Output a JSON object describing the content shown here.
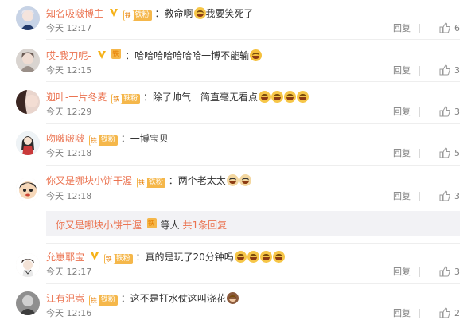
{
  "comments": [
    {
      "user": "知名吸啵博主",
      "verified": true,
      "fan_label": "铁粉",
      "text": "救命啊",
      "text2": "我要笑死了",
      "emojis_mid": [
        "laugh"
      ],
      "emojis_end": [],
      "time": "今天 12:17",
      "reply": "回复",
      "likes": "6"
    },
    {
      "user": "哎-我刀呢-",
      "verified": true,
      "fan_label": "",
      "text": "哈哈哈哈哈哈哈一博不能输",
      "text2": "",
      "emojis_mid": [],
      "emojis_end": [
        "shh"
      ],
      "time": "今天 12:15",
      "reply": "回复",
      "likes": "3"
    },
    {
      "user": "迦叶-一片冬麦",
      "verified": false,
      "fan_label": "铁粉",
      "text": "除了帅气　简直毫无看点",
      "text2": "",
      "emojis_mid": [],
      "emojis_end": [
        "laugh",
        "laugh",
        "laugh",
        "laugh"
      ],
      "time": "今天 12:29",
      "reply": "回复",
      "likes": "3"
    },
    {
      "user": "吻啵啵啵",
      "verified": false,
      "fan_label": "铁粉",
      "text": "一博宝贝",
      "text2": "",
      "emojis_mid": [],
      "emojis_end": [],
      "time": "今天 12:18",
      "reply": "回复",
      "likes": "5"
    },
    {
      "user": "你又是哪块小饼干渥",
      "verified": false,
      "fan_label": "铁粉",
      "text": "两个老太太",
      "text2": "",
      "emojis_mid": [],
      "emojis_end": [
        "cat",
        "cat"
      ],
      "time": "今天 12:18",
      "reply": "回复",
      "likes": "3"
    },
    {
      "user": "允崽耶宝",
      "verified": true,
      "fan_label": "铁粉",
      "text": "真的是玩了20分钟吗",
      "text2": "",
      "emojis_mid": [],
      "emojis_end": [
        "laugh",
        "laugh",
        "laugh",
        "laugh"
      ],
      "time": "今天 12:17",
      "reply": "回复",
      "likes": "3"
    },
    {
      "user": "江有汜嵩",
      "verified": false,
      "fan_label": "铁粉",
      "text": "这不是打水仗这叫浇花",
      "text2": "",
      "emojis_mid": [],
      "emojis_end": [
        "monkey"
      ],
      "time": "今天 12:16",
      "reply": "回复",
      "likes": "2"
    }
  ],
  "sub_reply": {
    "user": "你又是哪块小饼干渥",
    "text": "等人",
    "count_text": "共1条回复"
  },
  "colors": {
    "username": "#eb7350",
    "meta": "#808080",
    "fan_badge": "#f5b74a",
    "sub_reply_bg": "#f2f2f5"
  }
}
